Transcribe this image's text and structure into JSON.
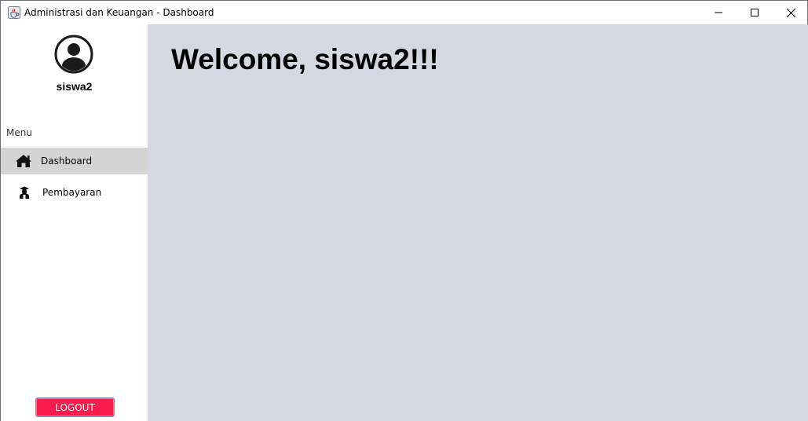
{
  "window": {
    "title": "Administrasi dan Keuangan - Dashboard",
    "icon": "java-cup-icon"
  },
  "sidebar": {
    "username": "siswa2",
    "menu_label": "Menu",
    "items": [
      {
        "label": "Dashboard",
        "icon": "home-icon",
        "active": true
      },
      {
        "label": "Pembayaran",
        "icon": "student-icon",
        "active": false
      }
    ],
    "logout_label": "LOGOUT"
  },
  "main": {
    "welcome": "Welcome, siswa2!!!"
  },
  "colors": {
    "main_bg": "#d5d8e0",
    "active_item_bg": "#d4d4d4",
    "logout_bg": "#fb1b4d"
  }
}
